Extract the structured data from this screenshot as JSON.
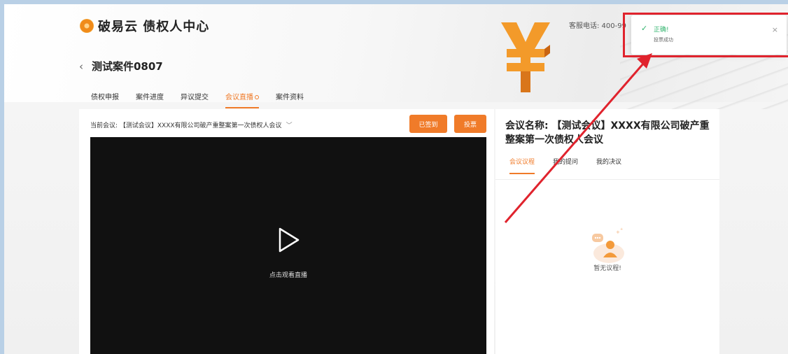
{
  "header": {
    "logo_text": "破易云 债权人中心",
    "service_phone": "客服电话: 400-99",
    "back_icon": "‹",
    "case_title": "测试案件0807"
  },
  "tabs": [
    {
      "label": "债权申报"
    },
    {
      "label": "案件进度"
    },
    {
      "label": "异议提交"
    },
    {
      "label": "会议直播",
      "active": true
    },
    {
      "label": "案件资料"
    }
  ],
  "left_panel": {
    "current_meeting": "当前会议: 【测试会议】XXXX有限公司破产重整案第一次债权人会议",
    "chevron": "﹀",
    "signed_label": "已签到",
    "vote_label": "投票",
    "video_label": "点击观看直播"
  },
  "right_panel": {
    "meeting_name": "会议名称: 【测试会议】XXXX有限公司破产重整案第一次债权人会议",
    "tabs": [
      {
        "label": "会议议程",
        "active": true
      },
      {
        "label": "我的提问"
      },
      {
        "label": "我的决议"
      }
    ],
    "empty_text": "暂无议程!"
  },
  "toast": {
    "check": "✓",
    "title": "正确!",
    "message": "投票成功",
    "close": "×"
  },
  "colors": {
    "accent": "#f07b29",
    "success": "#2fb36c",
    "annotation": "#e0232d"
  },
  "icons": [
    "logo-icon",
    "back-icon",
    "chevron-down-icon",
    "play-icon",
    "check-icon",
    "close-icon",
    "empty-agenda-icon"
  ]
}
